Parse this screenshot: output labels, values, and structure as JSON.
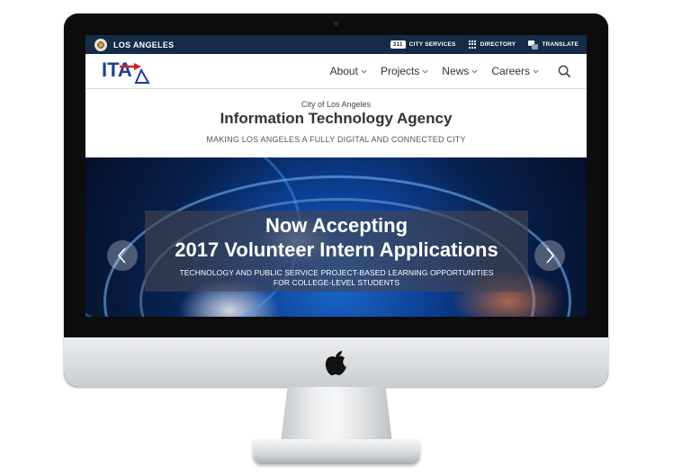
{
  "topbar": {
    "city_name": "LOS ANGELES",
    "services_badge": "311",
    "services_label": "CITY SERVICES",
    "directory_label": "DIRECTORY",
    "translate_label": "TRANSLATE",
    "background_color": "#152b46"
  },
  "navbar": {
    "logo_text": "ITA",
    "items": [
      {
        "label": "About"
      },
      {
        "label": "Projects"
      },
      {
        "label": "News"
      },
      {
        "label": "Careers"
      }
    ],
    "search_icon": "search-icon"
  },
  "header": {
    "small_title": "City of Los Angeles",
    "title": "Information Technology Agency",
    "tagline": "MAKING LOS ANGELES A FULLY DIGITAL AND CONNECTED CITY"
  },
  "hero": {
    "line1": "Now Accepting",
    "line2": "2017 Volunteer Intern Applications",
    "sub_line1": "TECHNOLOGY AND PUBLIC SERVICE PROJECT-BASED LEARNING OPPORTUNITIES",
    "sub_line2": "FOR COLLEGE-LEVEL STUDENTS",
    "prev_icon": "chevron-left-icon",
    "next_icon": "chevron-right-icon"
  },
  "device": {
    "brand_icon": "apple-logo-icon"
  }
}
